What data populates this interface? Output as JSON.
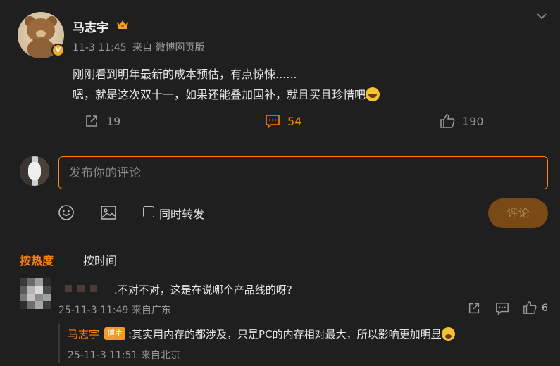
{
  "post": {
    "author": "马志宇",
    "time": "11-3 11:45",
    "source": "来自 微博网页版",
    "text_line1": "刚刚看到明年最新的成本预估，有点惊悚......",
    "text_line2": "嗯，就是这次双十一，如果还能叠加国补，就且买且珍惜吧",
    "share_count": "19",
    "comment_count": "54",
    "like_count": "190"
  },
  "composer": {
    "placeholder": "发布你的评论",
    "repost_label": "同时转发",
    "submit_label": "评论"
  },
  "sort_tabs": {
    "hot": "按热度",
    "time": "按时间"
  },
  "comments": [
    {
      "text": ".不对不对，这是在说哪个产品线的呀?",
      "time": "25-11-3 11:49",
      "location": "来自广东",
      "like_count": "6",
      "reply": {
        "author": "马志宇",
        "badge": "博主",
        "text": ":其实用内存的都涉及，只是PC的内存相对最大，所以影响更加明显",
        "time": "25-11-3 11:51",
        "location": "来自北京"
      }
    }
  ],
  "colors": {
    "accent": "#ff8200",
    "background": "#1f1f1f",
    "muted_text": "#9a9a9a"
  },
  "icons": {
    "share": "share-icon",
    "comment": "comment-icon",
    "like": "thumbs-up-icon",
    "emoji": "emoji-icon",
    "image": "image-icon",
    "menu": "chevron-down-icon"
  }
}
